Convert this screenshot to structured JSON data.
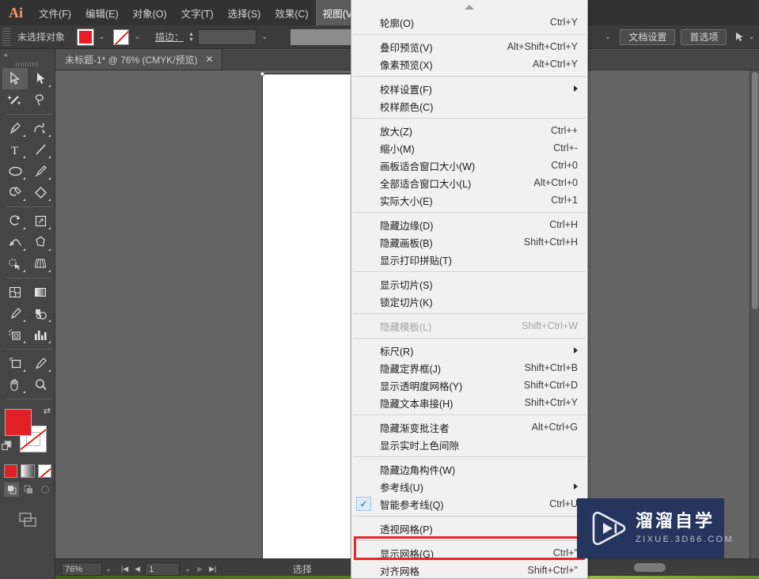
{
  "app": {
    "logo": "Ai",
    "menus": [
      {
        "label": "文件(F)",
        "active": false
      },
      {
        "label": "编辑(E)",
        "active": false
      },
      {
        "label": "对象(O)",
        "active": false
      },
      {
        "label": "文字(T)",
        "active": false
      },
      {
        "label": "选择(S)",
        "active": false
      },
      {
        "label": "效果(C)",
        "active": false
      },
      {
        "label": "视图(V)",
        "active": true
      }
    ]
  },
  "controlbar": {
    "selection_label": "未选择对象",
    "stroke_label": "描边：",
    "fill_color": "#ed1c24",
    "stroke_color": "none",
    "document_setup_label": "文档设置",
    "preferences_label": "首选项"
  },
  "tabbar": {
    "document_tab": "未标题-1* @ 76% (CMYK/预览)",
    "close_glyph": "✕"
  },
  "toolbox": {
    "collapse_glyph": "«",
    "tools": [
      {
        "name": "selection-tool",
        "selected": true
      },
      {
        "name": "direct-selection-tool",
        "selected": false
      },
      {
        "name": "magic-wand-tool",
        "selected": false
      },
      {
        "name": "lasso-tool",
        "selected": false
      },
      {
        "name": "pen-tool",
        "selected": false
      },
      {
        "name": "curvature-tool",
        "selected": false
      },
      {
        "name": "type-tool",
        "selected": false
      },
      {
        "name": "line-segment-tool",
        "selected": false
      },
      {
        "name": "ellipse-tool",
        "selected": false
      },
      {
        "name": "paintbrush-tool",
        "selected": false
      },
      {
        "name": "shaper-tool",
        "selected": false
      },
      {
        "name": "eraser-tool",
        "selected": false
      },
      {
        "name": "rotate-tool",
        "selected": false
      },
      {
        "name": "scale-tool",
        "selected": false
      },
      {
        "name": "width-tool",
        "selected": false
      },
      {
        "name": "free-transform-tool",
        "selected": false
      },
      {
        "name": "shape-builder-tool",
        "selected": false
      },
      {
        "name": "perspective-grid-tool",
        "selected": false
      },
      {
        "name": "mesh-tool",
        "selected": false
      },
      {
        "name": "gradient-tool",
        "selected": false
      },
      {
        "name": "eyedropper-tool",
        "selected": false
      },
      {
        "name": "blend-tool",
        "selected": false
      },
      {
        "name": "symbol-sprayer-tool",
        "selected": false
      },
      {
        "name": "column-graph-tool",
        "selected": false
      },
      {
        "name": "artboard-tool",
        "selected": false
      },
      {
        "name": "slice-tool",
        "selected": false
      },
      {
        "name": "hand-tool",
        "selected": false
      },
      {
        "name": "zoom-tool",
        "selected": false
      }
    ]
  },
  "statusbar": {
    "zoom_level": "76%",
    "page_number": "1",
    "status_text": "选择"
  },
  "menu_dropdown": {
    "title": "视图(V)",
    "groups": [
      {
        "items": [
          {
            "label": "轮廓(O)",
            "shortcut": "Ctrl+Y",
            "checked": false,
            "disabled": false,
            "submenu": false,
            "highlight": false
          }
        ]
      },
      {
        "items": [
          {
            "label": "叠印预览(V)",
            "shortcut": "Alt+Shift+Ctrl+Y",
            "checked": false,
            "disabled": false,
            "submenu": false,
            "highlight": false
          },
          {
            "label": "像素预览(X)",
            "shortcut": "Alt+Ctrl+Y",
            "checked": false,
            "disabled": false,
            "submenu": false,
            "highlight": false
          }
        ]
      },
      {
        "items": [
          {
            "label": "校样设置(F)",
            "shortcut": "",
            "checked": false,
            "disabled": false,
            "submenu": true,
            "highlight": false
          },
          {
            "label": "校样颜色(C)",
            "shortcut": "",
            "checked": false,
            "disabled": false,
            "submenu": false,
            "highlight": false
          }
        ]
      },
      {
        "items": [
          {
            "label": "放大(Z)",
            "shortcut": "Ctrl++",
            "checked": false,
            "disabled": false,
            "submenu": false,
            "highlight": false
          },
          {
            "label": "缩小(M)",
            "shortcut": "Ctrl+-",
            "checked": false,
            "disabled": false,
            "submenu": false,
            "highlight": false
          },
          {
            "label": "画板适合窗口大小(W)",
            "shortcut": "Ctrl+0",
            "checked": false,
            "disabled": false,
            "submenu": false,
            "highlight": false
          },
          {
            "label": "全部适合窗口大小(L)",
            "shortcut": "Alt+Ctrl+0",
            "checked": false,
            "disabled": false,
            "submenu": false,
            "highlight": false
          },
          {
            "label": "实际大小(E)",
            "shortcut": "Ctrl+1",
            "checked": false,
            "disabled": false,
            "submenu": false,
            "highlight": false
          }
        ]
      },
      {
        "items": [
          {
            "label": "隐藏边缘(D)",
            "shortcut": "Ctrl+H",
            "checked": false,
            "disabled": false,
            "submenu": false,
            "highlight": false
          },
          {
            "label": "隐藏画板(B)",
            "shortcut": "Shift+Ctrl+H",
            "checked": false,
            "disabled": false,
            "submenu": false,
            "highlight": false
          },
          {
            "label": "显示打印拼贴(T)",
            "shortcut": "",
            "checked": false,
            "disabled": false,
            "submenu": false,
            "highlight": false
          }
        ]
      },
      {
        "items": [
          {
            "label": "显示切片(S)",
            "shortcut": "",
            "checked": false,
            "disabled": false,
            "submenu": false,
            "highlight": false
          },
          {
            "label": "锁定切片(K)",
            "shortcut": "",
            "checked": false,
            "disabled": false,
            "submenu": false,
            "highlight": false
          }
        ]
      },
      {
        "items": [
          {
            "label": "隐藏模板(L)",
            "shortcut": "Shift+Ctrl+W",
            "checked": false,
            "disabled": true,
            "submenu": false,
            "highlight": false
          }
        ]
      },
      {
        "items": [
          {
            "label": "标尺(R)",
            "shortcut": "",
            "checked": false,
            "disabled": false,
            "submenu": true,
            "highlight": false
          },
          {
            "label": "隐藏定界框(J)",
            "shortcut": "Shift+Ctrl+B",
            "checked": false,
            "disabled": false,
            "submenu": false,
            "highlight": false
          },
          {
            "label": "显示透明度网格(Y)",
            "shortcut": "Shift+Ctrl+D",
            "checked": false,
            "disabled": false,
            "submenu": false,
            "highlight": false
          },
          {
            "label": "隐藏文本串接(H)",
            "shortcut": "Shift+Ctrl+Y",
            "checked": false,
            "disabled": false,
            "submenu": false,
            "highlight": false
          }
        ]
      },
      {
        "items": [
          {
            "label": "隐藏渐变批注者",
            "shortcut": "Alt+Ctrl+G",
            "checked": false,
            "disabled": false,
            "submenu": false,
            "highlight": false
          },
          {
            "label": "显示实时上色间隙",
            "shortcut": "",
            "checked": false,
            "disabled": false,
            "submenu": false,
            "highlight": false
          }
        ]
      },
      {
        "items": [
          {
            "label": "隐藏边角构件(W)",
            "shortcut": "",
            "checked": false,
            "disabled": false,
            "submenu": false,
            "highlight": false
          },
          {
            "label": "参考线(U)",
            "shortcut": "",
            "checked": false,
            "disabled": false,
            "submenu": true,
            "highlight": false
          },
          {
            "label": "智能参考线(Q)",
            "shortcut": "Ctrl+U",
            "checked": true,
            "disabled": false,
            "submenu": false,
            "highlight": false
          }
        ]
      },
      {
        "items": [
          {
            "label": "透视网格(P)",
            "shortcut": "",
            "checked": false,
            "disabled": false,
            "submenu": false,
            "highlight": false
          }
        ]
      },
      {
        "items": [
          {
            "label": "显示网格(G)",
            "shortcut": "Ctrl+\"",
            "checked": false,
            "disabled": false,
            "submenu": false,
            "highlight": true
          },
          {
            "label": "对齐网格",
            "shortcut": "Shift+Ctrl+\"",
            "checked": false,
            "disabled": false,
            "submenu": false,
            "highlight": false
          }
        ]
      }
    ],
    "annotation_color": "#e8252a",
    "check_glyph": "✓"
  },
  "watermark": {
    "title": "溜溜自学",
    "subtitle": "ZIXUE.3D66.COM",
    "bg_color": "#25355e"
  }
}
